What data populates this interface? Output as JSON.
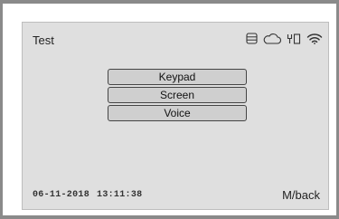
{
  "window": {
    "title": "Test"
  },
  "status_icons": [
    "database-icon",
    "cloud-icon",
    "usb-icon",
    "wifi-icon"
  ],
  "menu": {
    "items": [
      {
        "label": "Keypad"
      },
      {
        "label": "Screen"
      },
      {
        "label": "Voice"
      }
    ]
  },
  "footer": {
    "date": "06-11-2018",
    "time": "13:11:38",
    "back_label": "M/back"
  },
  "colors": {
    "screen_bg": "#dfdfdf",
    "button_bg": "#cfcfcf",
    "bezel": "#8a8a8a"
  }
}
